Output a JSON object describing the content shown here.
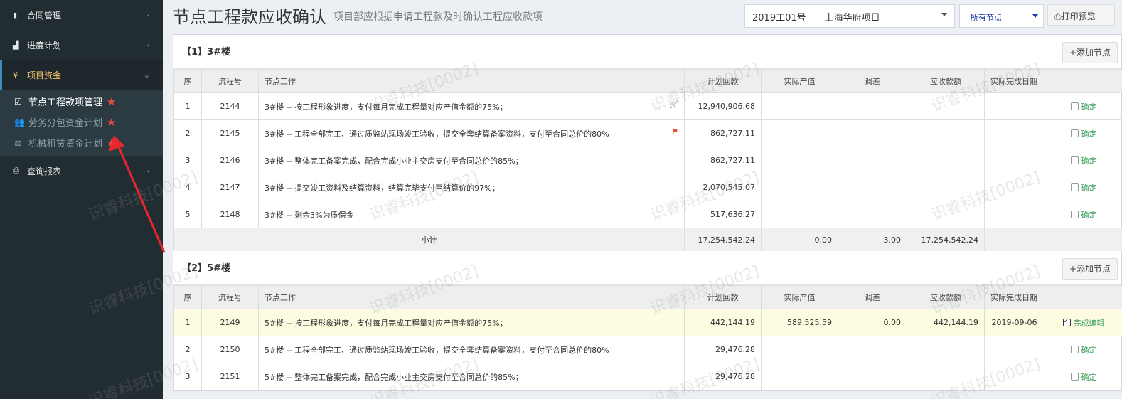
{
  "sidebar": {
    "items": [
      {
        "label": "合同管理"
      },
      {
        "label": "进度计划"
      },
      {
        "label": "项目资金"
      },
      {
        "label": "查询报表"
      }
    ],
    "sub_items": [
      {
        "label": "节点工程款项管理"
      },
      {
        "label": "劳务分包资金计划"
      },
      {
        "label": "机械租赁资金计划"
      }
    ]
  },
  "header": {
    "title": "节点工程款应收确认",
    "subtitle": "项目部应根据申请工程款及时确认工程应收款项",
    "project_select": "2019工01号——上海华府项目",
    "node_select": "所有节点",
    "print_label": "打印预览"
  },
  "columns": [
    "序",
    "流程号",
    "节点工作",
    "计划回款",
    "实际产值",
    "调差",
    "应收款额",
    "实际完成日期"
  ],
  "add_node_label": "+添加节点",
  "sections": [
    {
      "title": "【1】3#楼",
      "rows": [
        {
          "seq": "1",
          "flow": "2144",
          "work": "3#楼 -- 按工程形象进度，支付每月完成工程量对应产值金额的75%；",
          "plan": "12,940,906.68",
          "actual": "",
          "adj": "",
          "receivable": "",
          "date": "",
          "action": "确定",
          "checked": false,
          "icon": "cart-icon"
        },
        {
          "seq": "2",
          "flow": "2145",
          "work": "3#楼 -- 工程全部完工、通过质监站现场竣工验收，提交全套结算备案资料，支付至合同总价的80%",
          "plan": "862,727.11",
          "actual": "",
          "adj": "",
          "receivable": "",
          "date": "",
          "action": "确定",
          "checked": false,
          "icon": "flag-icon"
        },
        {
          "seq": "3",
          "flow": "2146",
          "work": "3#楼 -- 整体完工备案完成，配合完成小业主交房支付至合同总价的85%；",
          "plan": "862,727.11",
          "actual": "",
          "adj": "",
          "receivable": "",
          "date": "",
          "action": "确定",
          "checked": false
        },
        {
          "seq": "4",
          "flow": "2147",
          "work": "3#楼 -- 提交竣工资料及结算资料，结算完毕支付至结算价的97%；",
          "plan": "2,070,545.07",
          "actual": "",
          "adj": "",
          "receivable": "",
          "date": "",
          "action": "确定",
          "checked": false
        },
        {
          "seq": "5",
          "flow": "2148",
          "work": "3#楼 -- 剩余3%为质保金",
          "plan": "517,636.27",
          "actual": "",
          "adj": "",
          "receivable": "",
          "date": "",
          "action": "确定",
          "checked": false
        }
      ],
      "subtotal": {
        "label": "小计",
        "plan": "17,254,542.24",
        "actual": "0.00",
        "adj": "3.00",
        "receivable": "17,254,542.24"
      }
    },
    {
      "title": "【2】5#楼",
      "rows": [
        {
          "seq": "1",
          "flow": "2149",
          "work": "5#楼 -- 按工程形象进度，支付每月完成工程量对应产值金额的75%；",
          "plan": "442,144.19",
          "actual": "589,525.59",
          "adj": "0.00",
          "receivable": "442,144.19",
          "date": "2019-09-06",
          "action": "完成编辑",
          "checked": true
        },
        {
          "seq": "2",
          "flow": "2150",
          "work": "5#楼 -- 工程全部完工、通过质监站现场竣工验收，提交全套结算备案资料，支付至合同总价的80%",
          "plan": "29,476.28",
          "actual": "",
          "adj": "",
          "receivable": "",
          "date": "",
          "action": "确定",
          "checked": false
        },
        {
          "seq": "3",
          "flow": "2151",
          "work": "5#楼 -- 整体完工备案完成，配合完成小业主交房支付至合同总价的85%；",
          "plan": "29,476.28",
          "actual": "",
          "adj": "",
          "receivable": "",
          "date": "",
          "action": "确定",
          "checked": false
        }
      ]
    }
  ],
  "watermark": "识睿科技[0002]"
}
